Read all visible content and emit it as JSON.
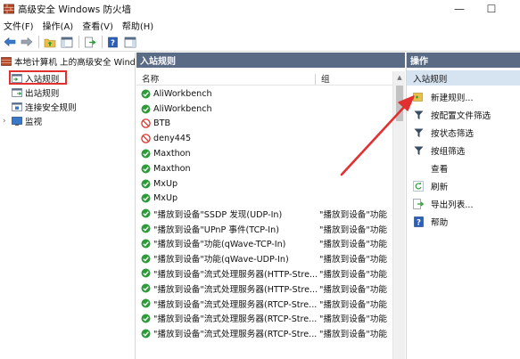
{
  "window": {
    "title": "高级安全 Windows 防火墙",
    "minimize_glyph": "—",
    "maximize_glyph": "☐"
  },
  "menu": [
    "文件(F)",
    "操作(A)",
    "查看(V)",
    "帮助(H)"
  ],
  "tree": {
    "root": "本地计算机 上的高级安全 Windows",
    "items": [
      {
        "label": "入站规则",
        "selected": true
      },
      {
        "label": "出站规则",
        "selected": false
      },
      {
        "label": "连接安全规则",
        "selected": false
      },
      {
        "label": "监视",
        "selected": false
      }
    ]
  },
  "rules_pane": {
    "title": "入站规则",
    "col_name": "名称",
    "col_group": "组",
    "rows": [
      {
        "name": "AliWorkbench",
        "group": "",
        "status": "allow"
      },
      {
        "name": "AliWorkbench",
        "group": "",
        "status": "allow"
      },
      {
        "name": "BTB",
        "group": "",
        "status": "block"
      },
      {
        "name": "deny445",
        "group": "",
        "status": "block"
      },
      {
        "name": "Maxthon",
        "group": "",
        "status": "allow"
      },
      {
        "name": "Maxthon",
        "group": "",
        "status": "allow"
      },
      {
        "name": "MxUp",
        "group": "",
        "status": "allow"
      },
      {
        "name": "MxUp",
        "group": "",
        "status": "allow"
      },
      {
        "name": "\"播放到设备\"SSDP 发现(UDP-In)",
        "group": "\"播放到设备\"功能",
        "status": "allow"
      },
      {
        "name": "\"播放到设备\"UPnP 事件(TCP-In)",
        "group": "\"播放到设备\"功能",
        "status": "allow"
      },
      {
        "name": "\"播放到设备\"功能(qWave-TCP-In)",
        "group": "\"播放到设备\"功能",
        "status": "allow"
      },
      {
        "name": "\"播放到设备\"功能(qWave-UDP-In)",
        "group": "\"播放到设备\"功能",
        "status": "allow"
      },
      {
        "name": "\"播放到设备\"流式处理服务器(HTTP-Stre...",
        "group": "\"播放到设备\"功能",
        "status": "allow"
      },
      {
        "name": "\"播放到设备\"流式处理服务器(HTTP-Stre...",
        "group": "\"播放到设备\"功能",
        "status": "allow"
      },
      {
        "name": "\"播放到设备\"流式处理服务器(RTCP-Stre...",
        "group": "\"播放到设备\"功能",
        "status": "allow"
      },
      {
        "name": "\"播放到设备\"流式处理服务器(RTCP-Stre...",
        "group": "\"播放到设备\"功能",
        "status": "allow"
      },
      {
        "name": "\"播放到设备\"流式处理服务器(RTCP-Stre...",
        "group": "\"播放到设备\"功能",
        "status": "allow"
      }
    ]
  },
  "actions_pane": {
    "title": "操作",
    "section": "入站规则",
    "items": [
      {
        "label": "新建规则...",
        "icon": "new-rule-icon"
      },
      {
        "label": "按配置文件筛选",
        "icon": "filter-icon"
      },
      {
        "label": "按状态筛选",
        "icon": "filter-icon"
      },
      {
        "label": "按组筛选",
        "icon": "filter-icon"
      },
      {
        "label": "查看",
        "icon": ""
      },
      {
        "label": "刷新",
        "icon": "refresh-icon"
      },
      {
        "label": "导出列表...",
        "icon": "export-icon"
      },
      {
        "label": "帮助",
        "icon": "help-icon"
      }
    ]
  },
  "colors": {
    "pane_header": "#5a6b86",
    "action_section": "#d6e3f1",
    "allow_green": "#2e9b3a",
    "block_red": "#d9352b",
    "annotation_red": "#e23030"
  }
}
